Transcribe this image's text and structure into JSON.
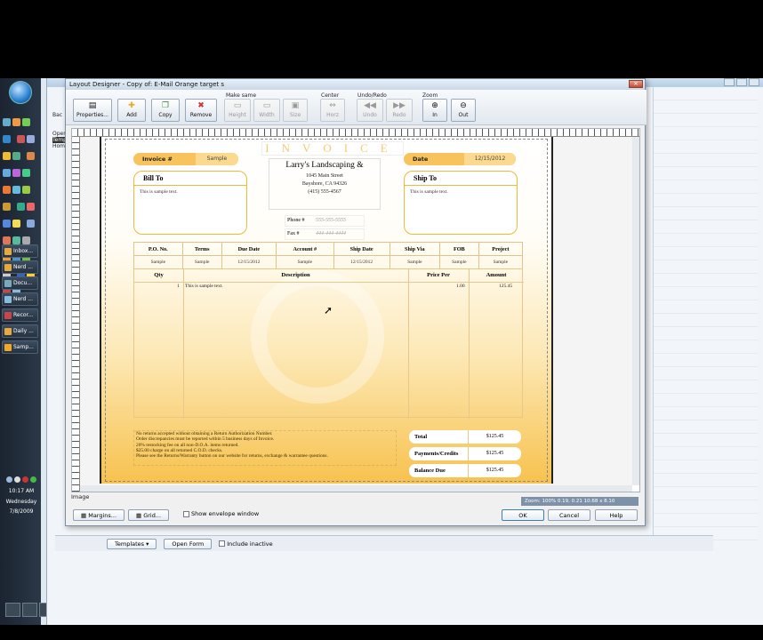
{
  "taskbar": {
    "tasks": [
      "Inbox...",
      "Nerd ...",
      "Docu...",
      "Nerd ...",
      "Recor...",
      "Daily ...",
      "Samp..."
    ],
    "clock": {
      "time": "10:17 AM",
      "day": "Wednesday",
      "date": "7/8/2009"
    }
  },
  "background_app": {
    "side_labels": [
      "Bac",
      "Open",
      "Temp",
      "Home"
    ]
  },
  "dialog": {
    "title": "Layout Designer - Copy of: E-Mail Orange target s",
    "close_icon": "close-icon",
    "toolbar": {
      "groups": {
        "make_same": "Make same",
        "center": "Center",
        "undo_redo": "Undo/Redo",
        "zoom": "Zoom"
      },
      "buttons": {
        "properties": "Properties...",
        "add": "Add",
        "copy": "Copy",
        "remove": "Remove",
        "height": "Height",
        "width": "Width",
        "size": "Size",
        "horz": "Horz",
        "undo": "Undo",
        "redo": "Redo",
        "zoom_in": "In",
        "zoom_out": "Out"
      }
    },
    "invoice": {
      "title": "INVOICE",
      "invoice_no_label": "Invoice #",
      "invoice_no_value": "Sample",
      "date_label": "Date",
      "date_value": "12/15/2012",
      "bill_to_label": "Bill To",
      "bill_to_text": "This is sample text.",
      "ship_to_label": "Ship To",
      "ship_to_text": "This is sample text.",
      "company": {
        "name": "Larry's Landscaping &",
        "street": "1045 Main Street",
        "city": "Bayshore, CA 94326",
        "phone_line": "(415) 555-4567"
      },
      "phone_label": "Phone #",
      "phone_value": "555-555-5555",
      "fax_label": "Fax #",
      "fax_value": "444-444-4444",
      "info_headers": [
        "P.O. No.",
        "Terms",
        "Due Date",
        "Account #",
        "Ship Date",
        "Ship Via",
        "FOB",
        "Project"
      ],
      "info_values": [
        "Sample",
        "Sample",
        "12/15/2012",
        "Sample",
        "12/15/2012",
        "Sample",
        "Sample",
        "Sample"
      ],
      "item_headers": {
        "qty": "Qty",
        "description": "Description",
        "price_per": "Price Per",
        "amount": "Amount"
      },
      "item_row": {
        "qty": "1",
        "description": "This is sample text.",
        "price_per": "1.00",
        "amount": "125.45"
      },
      "terms_text": [
        "No returns accepted without obtaining a Return Authorization Number.",
        "Order discrepancies must be reported within 5 business days of Invoice.",
        "20% restocking fee on all non-D.O.A. items returned.",
        "$25.00 charge on all returned C.O.D. checks.",
        "Please see the Returns/Warranty button on our website for returns, exchange & warrantee questions."
      ],
      "totals": [
        {
          "label": "Total",
          "value": "$125.45"
        },
        {
          "label": "Payments/Credits",
          "value": "$125.45"
        },
        {
          "label": "Balance Due",
          "value": "$125.45"
        }
      ]
    },
    "status_text": "Image",
    "zoom_readout": "Zoom: 100%    0.19, 0.21    10.68 x 8.10",
    "footer": {
      "margins": "Margins...",
      "grid": "Grid...",
      "show_envelope": "Show envelope window",
      "ok": "OK",
      "cancel": "Cancel",
      "help": "Help"
    }
  },
  "bottom_bar": {
    "templates": "Templates",
    "open_form": "Open Form",
    "include_inactive": "Include inactive"
  }
}
